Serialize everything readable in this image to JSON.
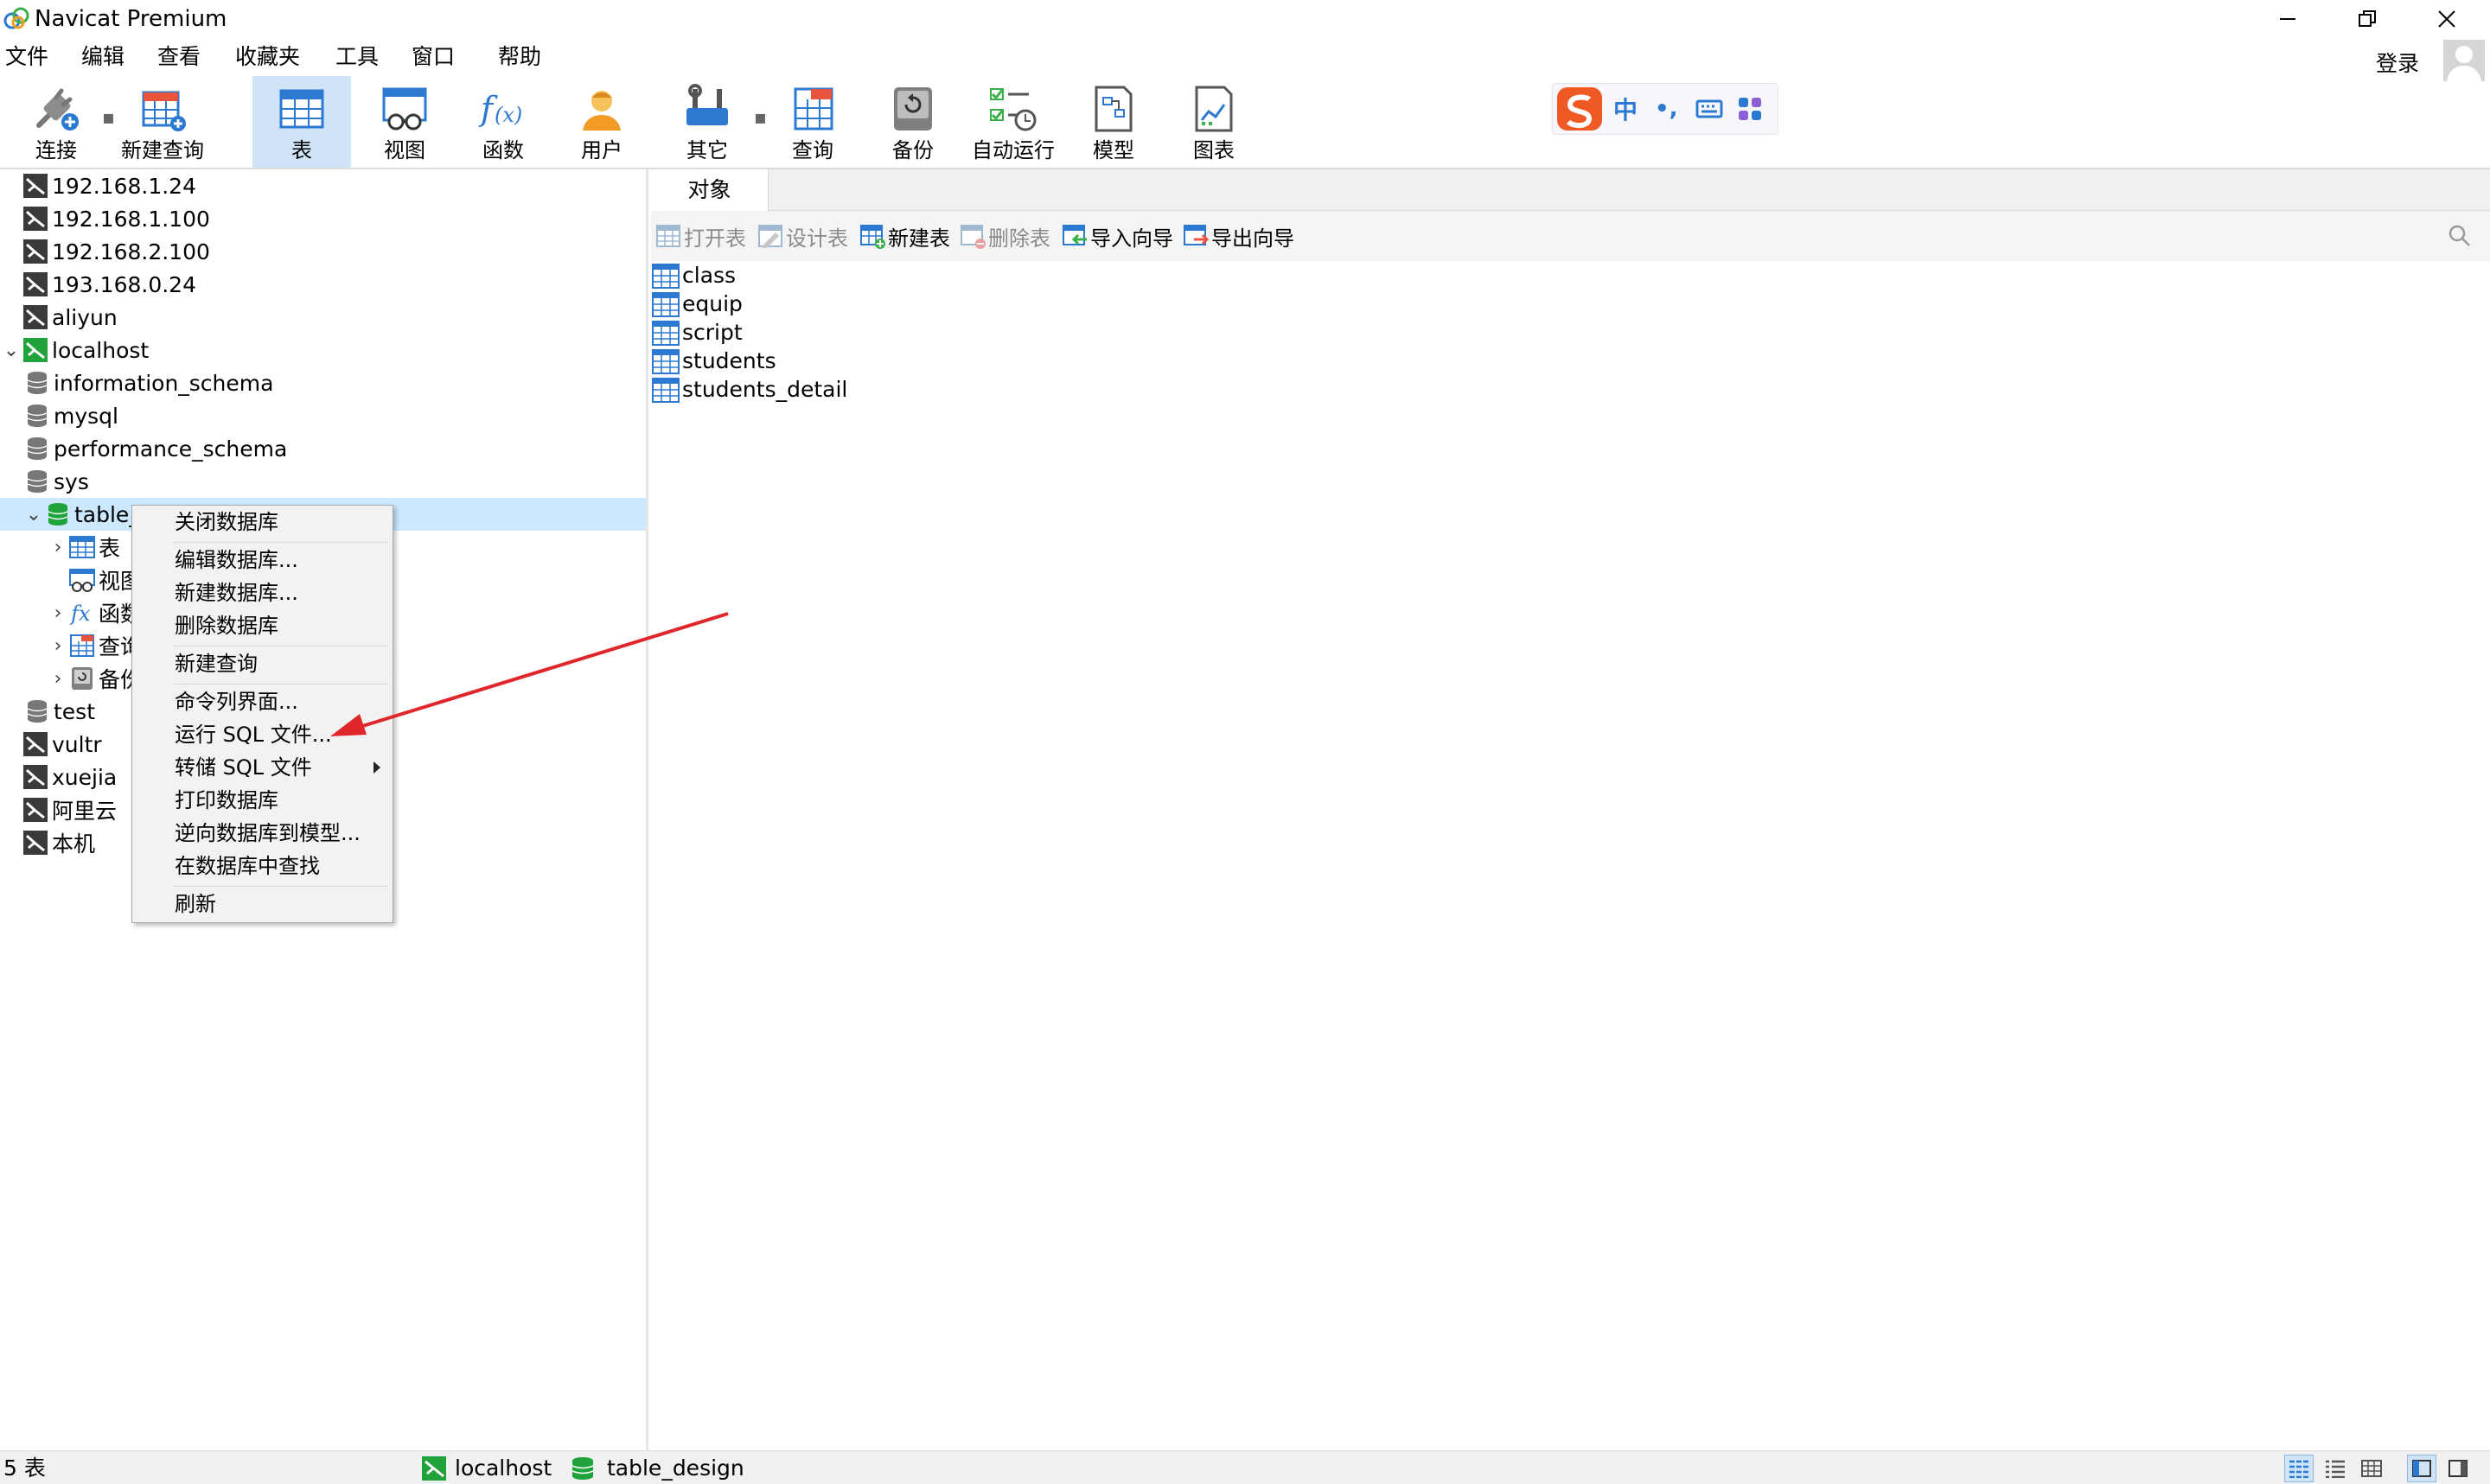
{
  "window": {
    "title": "Navicat Premium"
  },
  "menubar": {
    "items": [
      "文件",
      "编辑",
      "查看",
      "收藏夹",
      "工具",
      "窗口",
      "帮助"
    ],
    "login": "登录"
  },
  "toolbar": {
    "connect": "连接",
    "new_query": "新建查询",
    "table": "表",
    "view": "视图",
    "function": "函数",
    "user": "用户",
    "other": "其它",
    "query": "查询",
    "backup": "备份",
    "autorun": "自动运行",
    "model": "模型",
    "chart": "图表"
  },
  "ime": {
    "label": "中",
    "punct": "•,"
  },
  "sidebar": {
    "connections": [
      "192.168.1.24",
      "192.168.1.100",
      "192.168.2.100",
      "193.168.0.24",
      "aliyun"
    ],
    "localhost": "localhost",
    "databases": [
      "information_schema",
      "mysql",
      "performance_schema",
      "sys"
    ],
    "open_db": "table_design",
    "children": [
      "表",
      "视图",
      "函数",
      "查询",
      "备份"
    ],
    "after": [
      "test"
    ],
    "more_connections": [
      "vultr",
      "xuejia",
      "阿里云",
      "本机"
    ]
  },
  "context_menu": {
    "items": [
      "关闭数据库",
      "编辑数据库...",
      "新建数据库...",
      "删除数据库",
      "新建查询",
      "命令列界面...",
      "运行 SQL 文件...",
      "转储 SQL 文件",
      "打印数据库",
      "逆向数据库到模型...",
      "在数据库中查找",
      "刷新"
    ]
  },
  "main": {
    "tab": "对象",
    "actions": {
      "open": "打开表",
      "design": "设计表",
      "new": "新建表",
      "delete": "删除表",
      "import": "导入向导",
      "export": "导出向导"
    },
    "tables": [
      "class",
      "equip",
      "script",
      "students",
      "students_detail"
    ]
  },
  "statusbar": {
    "count": "5 表",
    "connection": "localhost",
    "database": "table_design"
  },
  "colors": {
    "accent_blue": "#2b79d0",
    "selection": "#cce8ff",
    "green_db": "#1fa33a",
    "arrow_red": "#e0262b"
  }
}
